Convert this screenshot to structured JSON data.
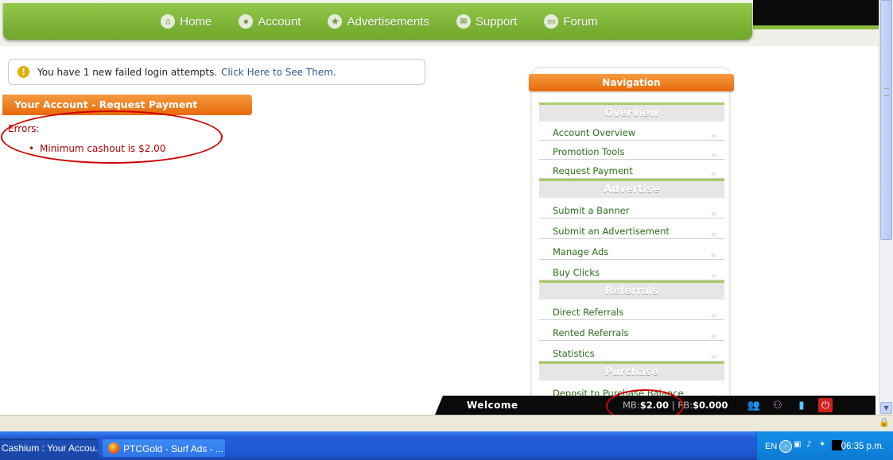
{
  "navbar": {
    "items": [
      {
        "label": "Home",
        "icon": "home-icon"
      },
      {
        "label": "Account",
        "icon": "user-icon"
      },
      {
        "label": "Advertisements",
        "icon": "star-icon"
      },
      {
        "label": "Support",
        "icon": "mail-icon"
      },
      {
        "label": "Forum",
        "icon": "chat-icon"
      }
    ]
  },
  "alert": {
    "message": "You have 1 new failed login attempts.",
    "link": "Click Here to See Them."
  },
  "section": {
    "title": "Your Account - Request Payment",
    "errors_title": "Errors:",
    "errors": [
      "Minimum cashout is $2.00"
    ]
  },
  "sidebar": {
    "header": "Navigation",
    "groups": [
      {
        "title": "Overview",
        "links": [
          "Account Overview",
          "Promotion Tools",
          "Request Payment"
        ]
      },
      {
        "title": "Advertise",
        "links": [
          "Submit a Banner",
          "Submit an Advertisement",
          "Manage Ads",
          "Buy Clicks"
        ]
      },
      {
        "title": "Referrals",
        "links": [
          "Direct Referrals",
          "Rented Referrals",
          "Statistics"
        ]
      },
      {
        "title": "Purchase",
        "links": [
          "Deposit to Purchase Balance"
        ]
      }
    ],
    "chevron": "«"
  },
  "statusbar": {
    "welcome": "Welcome",
    "mb_label": "MB:",
    "mb_value": "$2.00",
    "separator": "|",
    "pb_label": "PB:",
    "pb_value": "$0.000",
    "icons": [
      "group-icon",
      "referrals-icon",
      "stats-icon",
      "power-icon"
    ]
  },
  "taskbar": {
    "tasks": [
      "Cashium : Your Accou...",
      "PTCGold - Surf Ads - ..."
    ],
    "language": "EN",
    "clock": "06:35 p.m."
  },
  "colors": {
    "nav_green": "#7fb63a",
    "accent_orange": "#ee7a1c",
    "error_red": "#b00000",
    "link_green": "#2c6e1c"
  }
}
